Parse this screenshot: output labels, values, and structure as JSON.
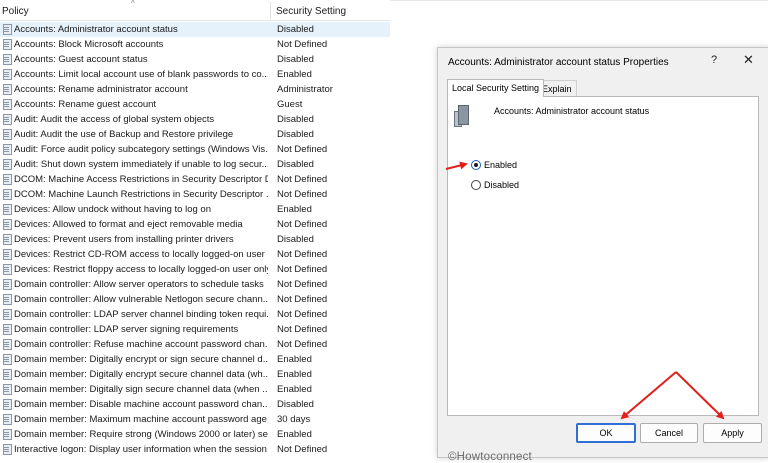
{
  "policy_list": {
    "headers": {
      "policy": "Policy",
      "setting": "Security Setting"
    },
    "rows": [
      {
        "name": "Accounts: Administrator account status",
        "value": "Disabled"
      },
      {
        "name": "Accounts: Block Microsoft accounts",
        "value": "Not Defined"
      },
      {
        "name": "Accounts: Guest account status",
        "value": "Disabled"
      },
      {
        "name": "Accounts: Limit local account use of blank passwords to co...",
        "value": "Enabled"
      },
      {
        "name": "Accounts: Rename administrator account",
        "value": "Administrator"
      },
      {
        "name": "Accounts: Rename guest account",
        "value": "Guest"
      },
      {
        "name": "Audit: Audit the access of global system objects",
        "value": "Disabled"
      },
      {
        "name": "Audit: Audit the use of Backup and Restore privilege",
        "value": "Disabled"
      },
      {
        "name": "Audit: Force audit policy subcategory settings (Windows Vis...",
        "value": "Not Defined"
      },
      {
        "name": "Audit: Shut down system immediately if unable to log secur...",
        "value": "Disabled"
      },
      {
        "name": "DCOM: Machine Access Restrictions in Security Descriptor D...",
        "value": "Not Defined"
      },
      {
        "name": "DCOM: Machine Launch Restrictions in Security Descriptor ...",
        "value": "Not Defined"
      },
      {
        "name": "Devices: Allow undock without having to log on",
        "value": "Enabled"
      },
      {
        "name": "Devices: Allowed to format and eject removable media",
        "value": "Not Defined"
      },
      {
        "name": "Devices: Prevent users from installing printer drivers",
        "value": "Disabled"
      },
      {
        "name": "Devices: Restrict CD-ROM access to locally logged-on user ...",
        "value": "Not Defined"
      },
      {
        "name": "Devices: Restrict floppy access to locally logged-on user only",
        "value": "Not Defined"
      },
      {
        "name": "Domain controller: Allow server operators to schedule tasks",
        "value": "Not Defined"
      },
      {
        "name": "Domain controller: Allow vulnerable Netlogon secure chann...",
        "value": "Not Defined"
      },
      {
        "name": "Domain controller: LDAP server channel binding token requi...",
        "value": "Not Defined"
      },
      {
        "name": "Domain controller: LDAP server signing requirements",
        "value": "Not Defined"
      },
      {
        "name": "Domain controller: Refuse machine account password chan...",
        "value": "Not Defined"
      },
      {
        "name": "Domain member: Digitally encrypt or sign secure channel d...",
        "value": "Enabled"
      },
      {
        "name": "Domain member: Digitally encrypt secure channel data (wh...",
        "value": "Enabled"
      },
      {
        "name": "Domain member: Digitally sign secure channel data (when ...",
        "value": "Enabled"
      },
      {
        "name": "Domain member: Disable machine account password chan...",
        "value": "Disabled"
      },
      {
        "name": "Domain member: Maximum machine account password age",
        "value": "30 days"
      },
      {
        "name": "Domain member: Require strong (Windows 2000 or later) se...",
        "value": "Enabled"
      },
      {
        "name": "Interactive logon: Display user information when the session...",
        "value": "Not Defined"
      }
    ]
  },
  "dialog": {
    "title": "Accounts: Administrator account status Properties",
    "help_glyph": "?",
    "close_glyph": "✕",
    "tabs": [
      "Local Security Setting",
      "Explain"
    ],
    "policy_name": "Accounts: Administrator account status",
    "options": [
      {
        "label": "Enabled",
        "selected": true
      },
      {
        "label": "Disabled",
        "selected": false
      }
    ],
    "watermark": "©Howtoconnect",
    "buttons": {
      "ok": "OK",
      "cancel": "Cancel",
      "apply": "Apply"
    }
  },
  "colors": {
    "arrow": "#e0201c",
    "selection": "#e5f1fb",
    "ok_border": "#2f6fd6"
  },
  "icons": {
    "policy_row": "policy-doc-icon",
    "dialog_policy": "server-policy-icon"
  }
}
